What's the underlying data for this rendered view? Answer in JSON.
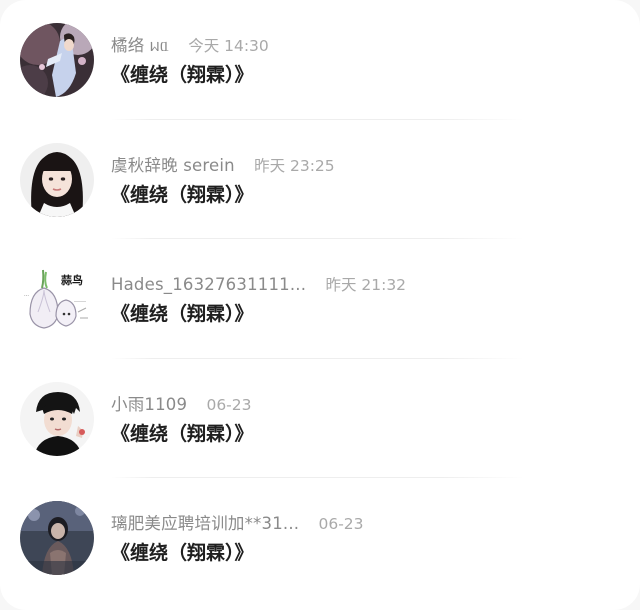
{
  "comments": [
    {
      "name": "橘络 ᥕᥲ",
      "time": "今天 14:30",
      "text": "《缠绕（翔霖）》",
      "avatar": "avatar-photo-hanfu"
    },
    {
      "name": "虞秋辞晚 serein",
      "time": "昨天 23:25",
      "text": "《缠绕（翔霖）》",
      "avatar": "avatar-photo-girl"
    },
    {
      "name": "Hades_16327631111...",
      "time": "昨天 21:32",
      "text": "《缠绕（翔霖）》",
      "avatar": "avatar-garlic-sticker",
      "avatar_label": "蒜鸟"
    },
    {
      "name": "小雨1109",
      "time": "06-23",
      "text": "《缠绕（翔霖）》",
      "avatar": "avatar-photo-boy"
    },
    {
      "name": "璃肥美应聘培训加**31...",
      "time": "06-23",
      "text": "《缠绕（翔霖）》",
      "avatar": "avatar-photo-dark"
    }
  ]
}
